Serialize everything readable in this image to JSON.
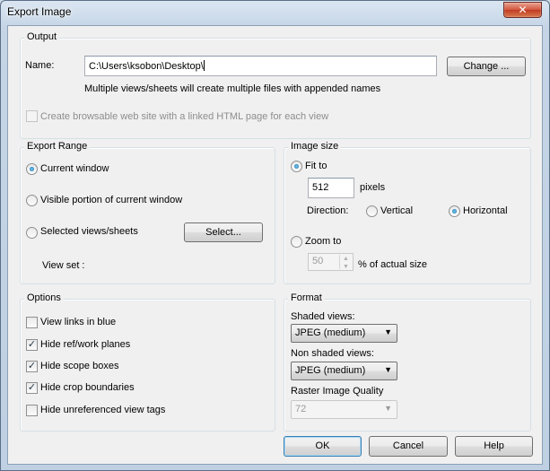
{
  "window": {
    "title": "Export Image",
    "close_glyph": "✕"
  },
  "output": {
    "group_label": "Output",
    "name_label": "Name:",
    "name_value": "C:\\Users\\ksobon\\Desktop\\",
    "change_button": "Change ...",
    "note": "Multiple views/sheets will create multiple files with appended names",
    "browsable_label": "Create browsable web site with a linked HTML page for each view",
    "browsable_checked": false
  },
  "export_range": {
    "group_label": "Export Range",
    "current_window": "Current window",
    "visible_portion": "Visible portion of current window",
    "selected_views": "Selected views/sheets",
    "select_button": "Select...",
    "view_set_label": "View set :",
    "selected": "current_window"
  },
  "image_size": {
    "group_label": "Image size",
    "fit_to_label": "Fit to",
    "pixels_value": "512",
    "pixels_label": "pixels",
    "direction_label": "Direction:",
    "vertical_label": "Vertical",
    "horizontal_label": "Horizontal",
    "direction_selected": "horizontal",
    "zoom_to_label": "Zoom to",
    "zoom_value": "50",
    "zoom_unit_label": "% of actual size",
    "mode_selected": "fit_to"
  },
  "options": {
    "group_label": "Options",
    "items": [
      {
        "label": "View links in blue",
        "checked": false
      },
      {
        "label": "Hide ref/work planes",
        "checked": true
      },
      {
        "label": "Hide scope boxes",
        "checked": true
      },
      {
        "label": "Hide crop boundaries",
        "checked": true
      },
      {
        "label": "Hide unreferenced view tags",
        "checked": false
      }
    ]
  },
  "format": {
    "group_label": "Format",
    "shaded_label": "Shaded views:",
    "shaded_value": "JPEG (medium)",
    "nonshaded_label": "Non shaded views:",
    "nonshaded_value": "JPEG (medium)",
    "quality_label": "Raster Image Quality",
    "quality_value": "72"
  },
  "footer": {
    "ok": "OK",
    "cancel": "Cancel",
    "help": "Help"
  },
  "icons": {
    "check_glyph": "✓",
    "dropdown_arrow": "▼",
    "spin_up": "▲",
    "spin_down": "▼"
  }
}
